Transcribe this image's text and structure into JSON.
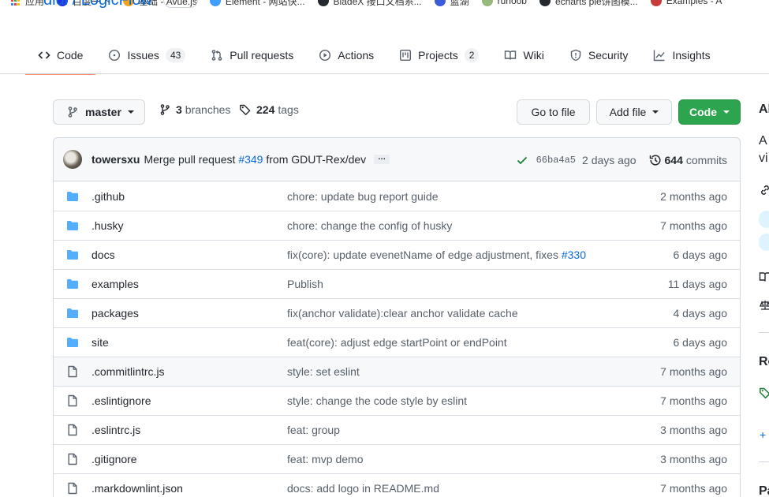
{
  "bookmarks": [
    {
      "label": "应用",
      "icon": "apps-grid-icon",
      "color": "#4285f4"
    },
    {
      "label": "百度一下",
      "icon": "baidu-icon",
      "color": "#2932e1"
    },
    {
      "label": "基础 - Avue.js",
      "icon": "avue-icon",
      "color": "#f4a41c"
    },
    {
      "label": "Element - 网站快...",
      "icon": "element-icon",
      "color": "#409eff"
    },
    {
      "label": "BladeX 接口文档系...",
      "icon": "github-icon",
      "color": "#24292f"
    },
    {
      "label": "蓝湖",
      "icon": "lanhu-icon",
      "color": "#3b5bdb"
    },
    {
      "label": "runoob",
      "icon": "runoob-icon",
      "color": "#96b97d"
    },
    {
      "label": "echarts pie饼图模...",
      "icon": "github-icon",
      "color": "#24292f"
    },
    {
      "label": "Examples - A",
      "icon": "examples-icon",
      "color": "#c93b3b"
    }
  ],
  "repo": {
    "owner_partial": "didi / LogicFlow"
  },
  "tabs": [
    {
      "label": "Code",
      "icon": "code-icon",
      "count": null,
      "selected": true
    },
    {
      "label": "Issues",
      "icon": "issue-icon",
      "count": "43",
      "selected": false
    },
    {
      "label": "Pull requests",
      "icon": "pull-request-icon",
      "count": null,
      "selected": false
    },
    {
      "label": "Actions",
      "icon": "play-icon",
      "count": null,
      "selected": false
    },
    {
      "label": "Projects",
      "icon": "project-icon",
      "count": "2",
      "selected": false
    },
    {
      "label": "Wiki",
      "icon": "book-icon",
      "count": null,
      "selected": false
    },
    {
      "label": "Security",
      "icon": "shield-icon",
      "count": null,
      "selected": false
    },
    {
      "label": "Insights",
      "icon": "graph-icon",
      "count": null,
      "selected": false
    }
  ],
  "toolbar": {
    "branch": "master",
    "branches_count": "3",
    "branches_label": "branches",
    "tags_count": "224",
    "tags_label": "tags",
    "goto_file": "Go to file",
    "add_file": "Add file",
    "code": "Code"
  },
  "commit": {
    "author": "towersxu",
    "message_prefix": "Merge pull request",
    "pr_link": "#349",
    "message_suffix": "from GDUT-Rex/dev",
    "ellipsis": "…",
    "sha": "66ba4a5",
    "ago": "2 days ago",
    "commits_count": "644",
    "commits_label": "commits"
  },
  "files": [
    {
      "type": "dir",
      "name": ".github",
      "message": "chore: update bug report guide",
      "link": "",
      "age": "2 months ago",
      "highlight": false
    },
    {
      "type": "dir",
      "name": ".husky",
      "message": "chore: change the config of husky",
      "link": "",
      "age": "7 months ago",
      "highlight": false
    },
    {
      "type": "dir",
      "name": "docs",
      "message": "fix(core): update evenetName of edge adjustment, fixes",
      "link": "#330",
      "age": "6 days ago",
      "highlight": false
    },
    {
      "type": "dir",
      "name": "examples",
      "message": "Publish",
      "link": "",
      "age": "11 days ago",
      "highlight": false
    },
    {
      "type": "dir",
      "name": "packages",
      "message": "fix(anchor validate):clear anchor validate cache",
      "link": "",
      "age": "4 days ago",
      "highlight": false
    },
    {
      "type": "dir",
      "name": "site",
      "message": "feat(core): adjust edge startPoint or endPoint",
      "link": "",
      "age": "6 days ago",
      "highlight": false
    },
    {
      "type": "file",
      "name": ".commitlintrc.js",
      "message": "style: set eslint",
      "link": "",
      "age": "7 months ago",
      "highlight": true
    },
    {
      "type": "file",
      "name": ".eslintignore",
      "message": "style: change the code style by eslint",
      "link": "",
      "age": "7 months ago",
      "highlight": false
    },
    {
      "type": "file",
      "name": ".eslintrc.js",
      "message": "feat: group",
      "link": "",
      "age": "3 months ago",
      "highlight": false
    },
    {
      "type": "file",
      "name": ".gitignore",
      "message": "feat: mvp demo",
      "link": "",
      "age": "3 months ago",
      "highlight": false
    },
    {
      "type": "file",
      "name": ".markdownlint.json",
      "message": "docs: add logo in README.md",
      "link": "",
      "age": "7 months ago",
      "highlight": false
    }
  ],
  "sidebar": {
    "about_heading_partial": "Al",
    "about_text_line1": "A",
    "about_text_line2": "vi",
    "releases_heading_partial": "Re",
    "release_plus": "+",
    "packages_heading_partial": "Pa"
  },
  "colors": {
    "accent_blue": "#0969da",
    "folder_blue": "#54aeff",
    "primary_green": "#2da44e",
    "tab_underline": "#fd8c73"
  }
}
